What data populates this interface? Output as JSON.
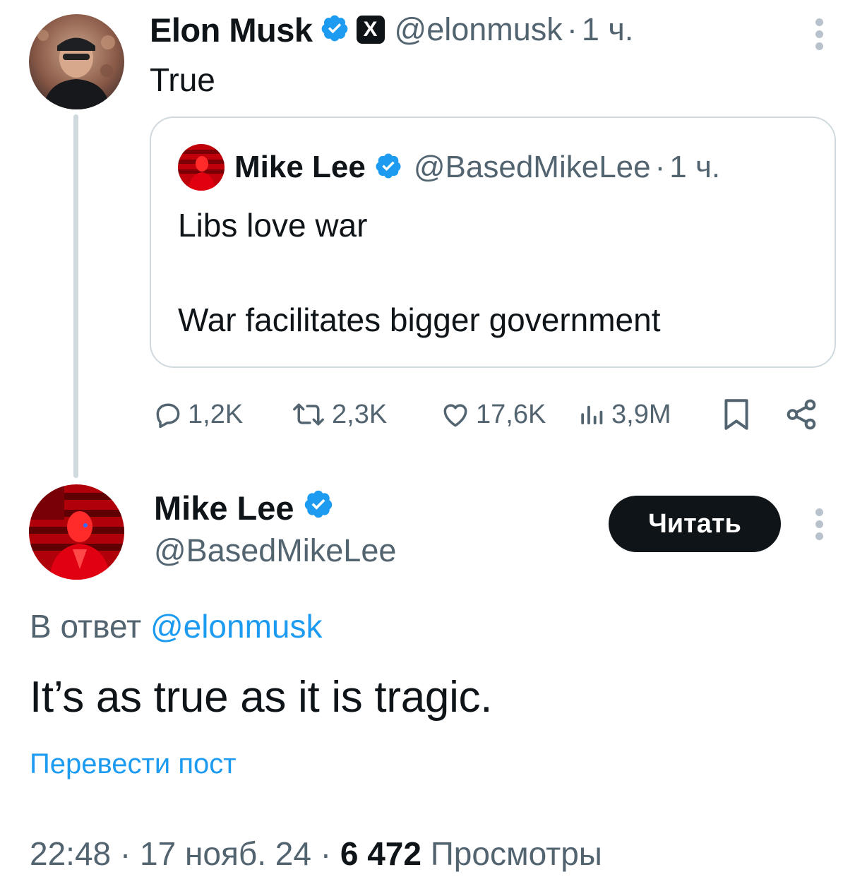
{
  "original_tweet": {
    "author_name": "Elon Musk",
    "handle": "@elonmusk",
    "separator": "·",
    "time": "1 ч.",
    "text": "True",
    "affiliate_badge_letter": "X",
    "quoted_tweet": {
      "author_name": "Mike Lee",
      "handle": "@BasedMikeLee",
      "separator": "·",
      "time": "1 ч.",
      "line1": "Libs love war",
      "line2": "War facilitates bigger government"
    },
    "actions": {
      "replies": "1,2K",
      "reposts": "2,3K",
      "likes": "17,6K",
      "views": "3,9M"
    }
  },
  "reply_tweet": {
    "author_name": "Mike Lee",
    "handle": "@BasedMikeLee",
    "follow_label": "Читать",
    "reply_to_prefix": "В ответ",
    "reply_to_handle": "@elonmusk",
    "text": "It’s as true as it is tragic.",
    "translate_label": "Перевести пост",
    "time": "22:48",
    "date": "17 нояб. 24",
    "separator": "·",
    "views_count": "6 472",
    "views_label": "Просмотры"
  },
  "colors": {
    "verified_blue": "#1d9bf0",
    "text_primary": "#0f1419",
    "text_muted": "#536471",
    "link": "#1d9bf0",
    "border": "#cfd9de"
  },
  "icons": [
    "verified-icon",
    "x-affiliate-icon",
    "more-options-icon",
    "reply-icon",
    "repost-icon",
    "like-icon",
    "views-icon",
    "bookmark-icon",
    "share-icon"
  ]
}
